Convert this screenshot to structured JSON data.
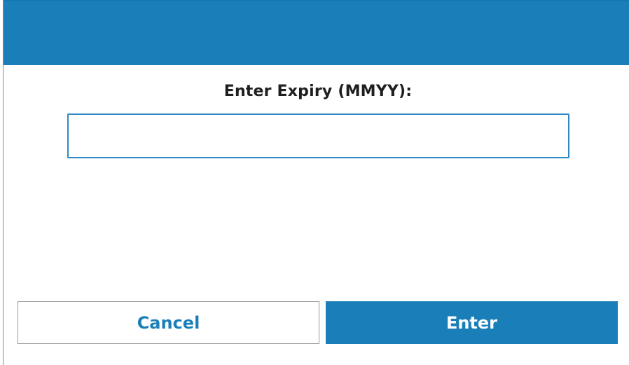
{
  "dialog": {
    "prompt_label": "Enter Expiry (MMYY):",
    "expiry_input": {
      "value": "",
      "placeholder": ""
    },
    "buttons": {
      "cancel_label": "Cancel",
      "enter_label": "Enter"
    }
  },
  "colors": {
    "accent": "#1a7fb9",
    "input_border": "#2f88c4",
    "text": "#1f1f1f"
  }
}
